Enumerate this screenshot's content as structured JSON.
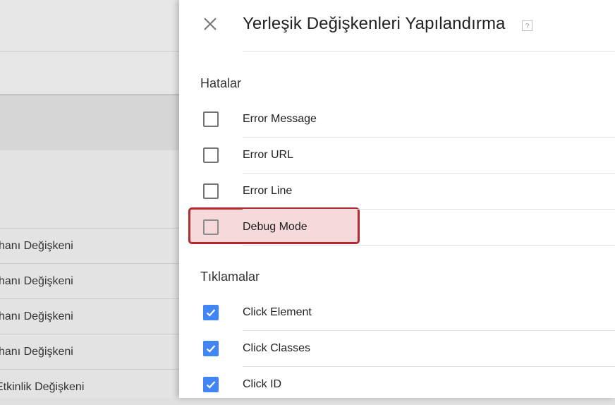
{
  "background": {
    "rows": [
      "hanı Değişkeni",
      "hanı Değişkeni",
      "hanı Değişkeni",
      "hanı Değişkeni",
      "Etkinlik Değişkeni"
    ]
  },
  "panel": {
    "title": "Yerleşik Değişkenleri Yapılandırma",
    "help_label": "?",
    "close_icon": "close-icon",
    "sections": [
      {
        "title": "Hatalar",
        "items": [
          {
            "label": "Error Message",
            "checked": false
          },
          {
            "label": "Error URL",
            "checked": false
          },
          {
            "label": "Error Line",
            "checked": false
          },
          {
            "label": "Debug Mode",
            "checked": false,
            "highlighted": true
          }
        ]
      },
      {
        "title": "Tıklamalar",
        "items": [
          {
            "label": "Click Element",
            "checked": true
          },
          {
            "label": "Click Classes",
            "checked": true
          },
          {
            "label": "Click ID",
            "checked": true
          }
        ]
      }
    ]
  },
  "colors": {
    "checkbox_checked": "#4285f4",
    "highlight_border": "#b12b2f",
    "highlight_fill": "#f3d5d8"
  }
}
